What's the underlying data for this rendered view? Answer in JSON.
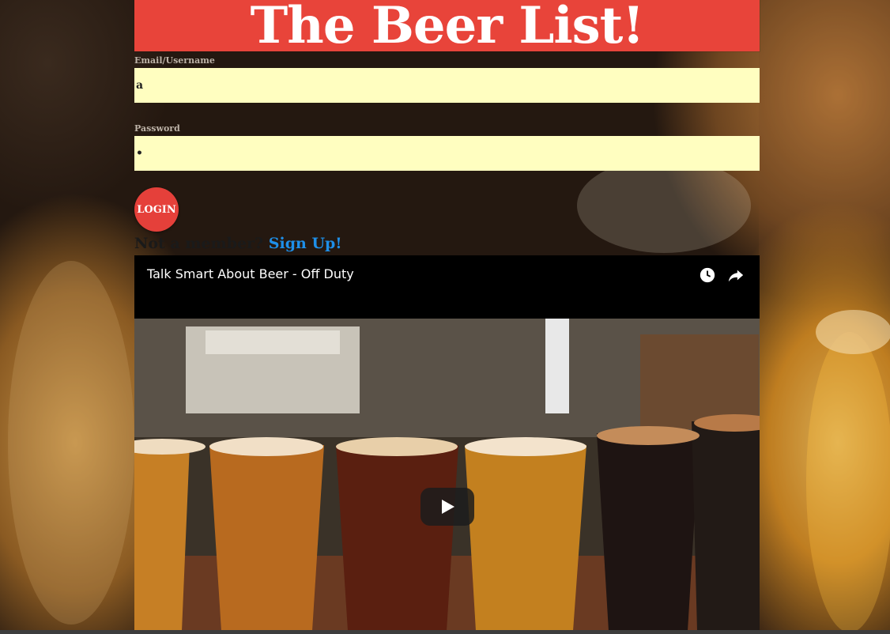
{
  "header": {
    "title": "The Beer List!"
  },
  "form": {
    "email_label": "Email/Username",
    "email_value": "a",
    "password_label": "Password",
    "password_value": "•",
    "login_label": "LOGIN"
  },
  "signup": {
    "prompt": "Not a member?",
    "link_label": "Sign Up!"
  },
  "video": {
    "title": "Talk Smart About Beer - Off Duty",
    "watch_later_icon": "clock-icon",
    "share_icon": "share-icon",
    "play_icon": "play-icon"
  },
  "colors": {
    "banner": "#e8443a",
    "input_bg": "#fffec0",
    "link": "#1e8fe8",
    "login_button": "#e5403a"
  }
}
